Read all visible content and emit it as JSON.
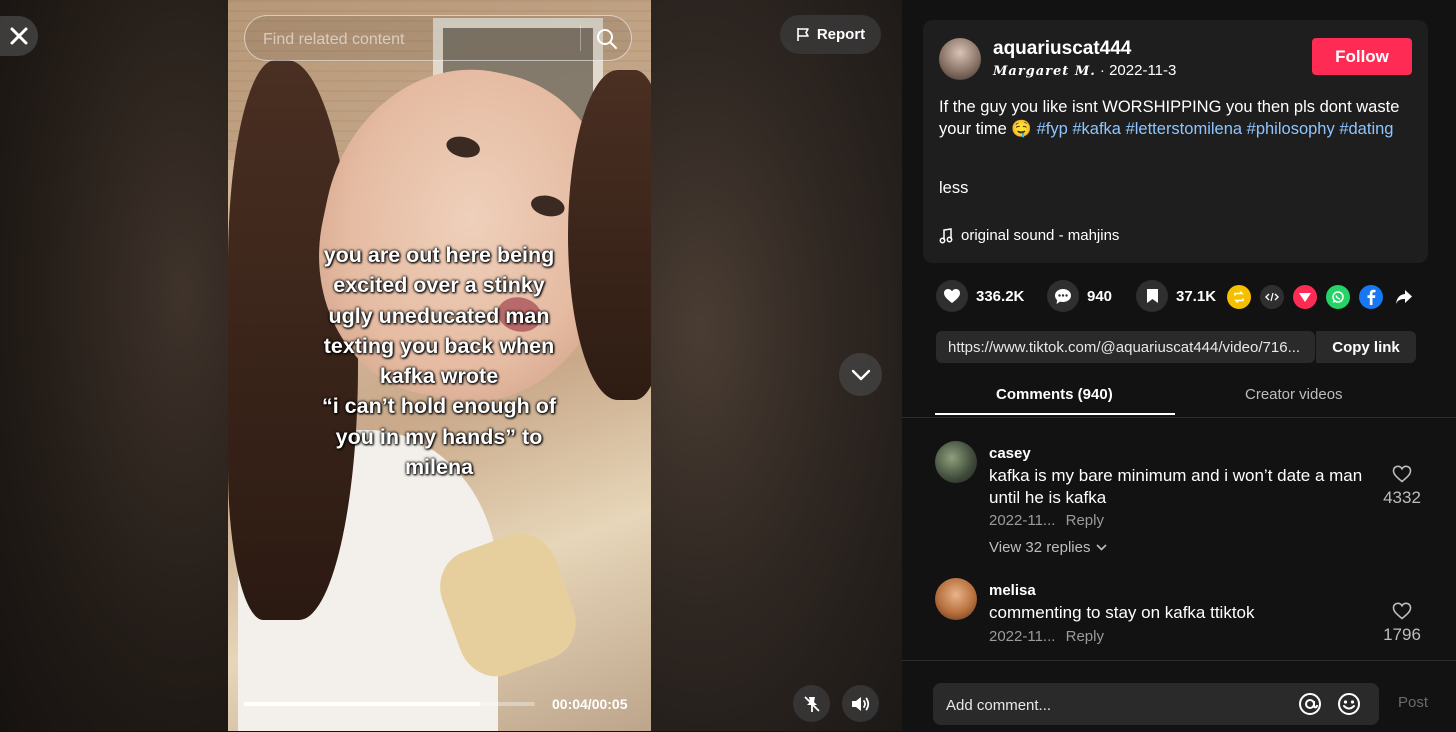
{
  "search": {
    "placeholder": "Find related content"
  },
  "video": {
    "caption": "you are out here being\nexcited over a stinky\nugly uneducated man\ntexting you back when\nkafka wrote\n“i can’t hold enough of\nyou in my hands” to\nmilena",
    "report_label": "Report",
    "time": "00:04/00:05",
    "progress": 0.81
  },
  "post": {
    "username": "aquariuscat444",
    "nickname": "𝑴𝒂𝒓𝒈𝒂𝒓𝒆𝒕 𝑴.",
    "separator": " · ",
    "date": "2022-11-3",
    "follow_label": "Follow",
    "description": "If the guy you like isnt WORSHIPPING you then pls dont waste your time 🤤 ",
    "hashtags": [
      "#fyp",
      "#kafka",
      "#letterstomilena",
      "#philosophy",
      "#dating"
    ],
    "less_label": "less",
    "sound": "original sound - mahjins"
  },
  "actions": {
    "likes": "336.2K",
    "comments": "940",
    "saves": "37.1K"
  },
  "share": {
    "link": "https://www.tiktok.com/@aquariuscat444/video/716...",
    "copy_label": "Copy link"
  },
  "tabs": {
    "comments": "Comments (940)",
    "creator": "Creator videos"
  },
  "comments": [
    {
      "user": "casey",
      "text": "kafka is my bare minimum and i won’t date a man until he is kafka",
      "date": "2022-11...",
      "reply_label": "Reply",
      "likes": "4332",
      "view_replies": "View 32 replies"
    },
    {
      "user": "melisa",
      "text": "commenting to stay on kafka ttiktok",
      "date": "2022-11...",
      "reply_label": "Reply",
      "likes": "1796"
    }
  ],
  "compose": {
    "placeholder": "Add comment...",
    "post_label": "Post"
  },
  "colors": {
    "follow": "#fe2c55",
    "hashtag": "#8ec5ff",
    "background": "#121212"
  }
}
